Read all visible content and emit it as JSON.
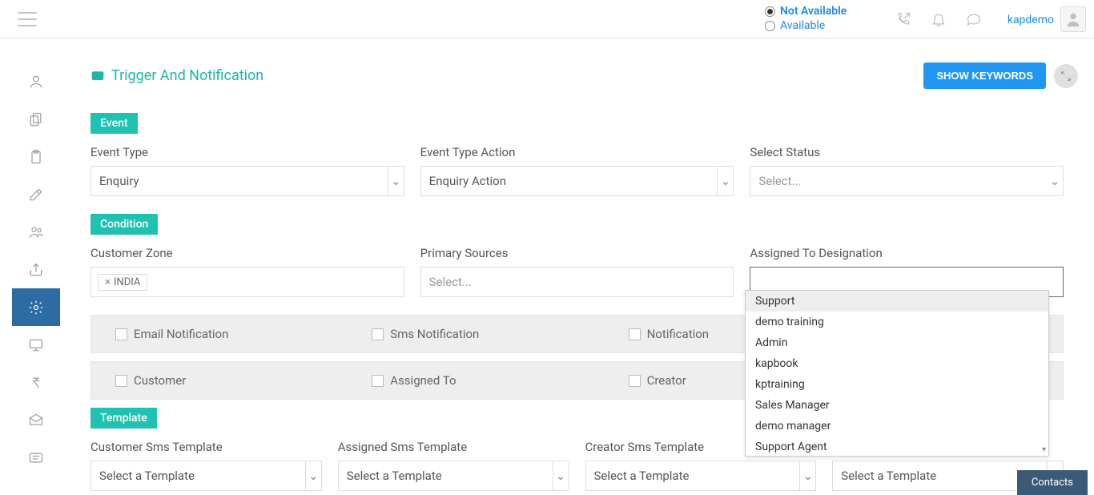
{
  "header": {
    "availability": {
      "not_available": "Not Available",
      "available": "Available"
    },
    "username": "kapdemo"
  },
  "page": {
    "title": "Trigger And Notification",
    "show_keywords": "SHOW KEYWORDS"
  },
  "sections": {
    "event": "Event",
    "condition": "Condition",
    "template": "Template"
  },
  "event": {
    "type_label": "Event Type",
    "type_value": "Enquiry",
    "action_label": "Event Type Action",
    "action_value": "Enquiry Action",
    "status_label": "Select Status",
    "status_placeholder": "Select..."
  },
  "condition": {
    "zone_label": "Customer Zone",
    "zone_tag": "INDIA",
    "sources_label": "Primary Sources",
    "sources_placeholder": "Select...",
    "designation_label": "Assigned To Designation"
  },
  "checks": {
    "email": "Email Notification",
    "sms": "Sms Notification",
    "notif": "Notification",
    "customer": "Customer",
    "assigned": "Assigned To",
    "creator": "Creator"
  },
  "templates": {
    "customer_label": "Customer Sms Template",
    "assigned_label": "Assigned Sms Template",
    "creator_label": "Creator Sms Template",
    "placeholder": "Select a Template",
    "extra_placeholder": "Select a Template"
  },
  "dropdown": {
    "options": [
      "Support",
      "demo training",
      "Admin",
      "kapbook",
      "kptraining",
      "Sales Manager",
      "demo manager",
      "Support Agent"
    ]
  },
  "footer": {
    "contacts": "Contacts"
  }
}
